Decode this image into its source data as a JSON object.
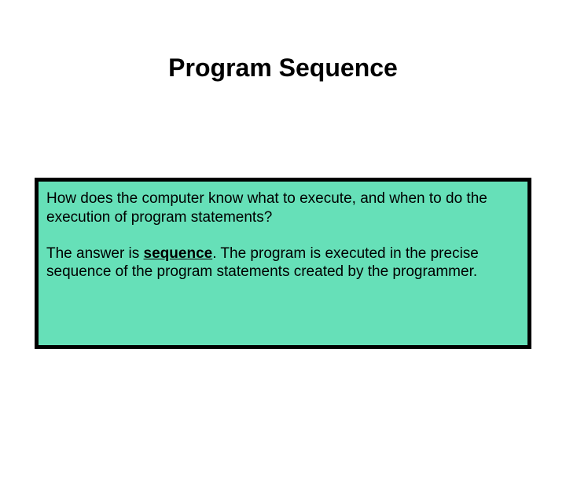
{
  "title": "Program Sequence",
  "paragraph1": "How does the computer know what to execute, and when to do the execution of program statements?",
  "paragraph2_part1": "The answer is ",
  "paragraph2_bold": "sequence",
  "paragraph2_part2": ".  The program is executed in the precise sequence of the program statements created by the programmer."
}
